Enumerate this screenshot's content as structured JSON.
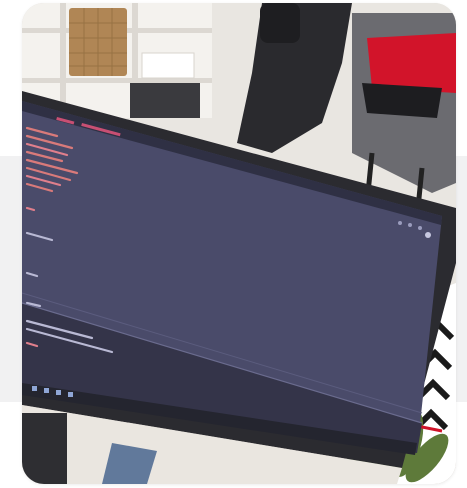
{
  "photo": {
    "subject": "desk-monitor-with-code-editor",
    "colors": {
      "wall": "#e9e6e1",
      "screen": "#4a4b6a",
      "screen_dark": "#343449",
      "bezel": "#2b2b30",
      "shelf": "#f4f2ee",
      "basket": "#b08655",
      "chair": "#2a2a2e",
      "red_cloth": "#d2142a",
      "plant": "#5e7a3a",
      "floor": "#cfc7bd"
    }
  }
}
